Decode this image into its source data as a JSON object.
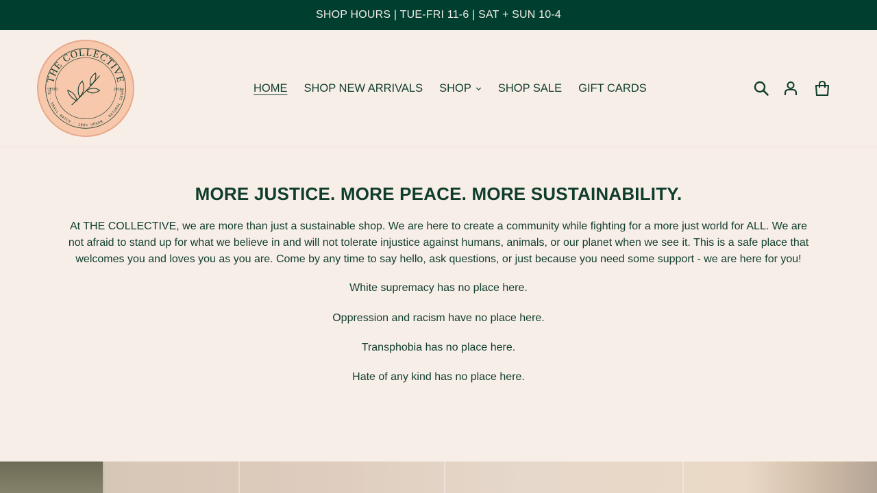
{
  "announcement": {
    "text": "SHOP HOURS | TUE-FRI 11-6 | SAT + SUN 10-4"
  },
  "header": {
    "logo": {
      "brand_name": "THE COLLECTIVE",
      "established_left": "ESTD",
      "established_right": "2019",
      "ring_text": "LOW WASTE · SMALL BATCH · 100% VEGAN · NATURAL INGREDIENTS"
    },
    "nav": [
      {
        "label": "HOME",
        "active": true
      },
      {
        "label": "SHOP NEW ARRIVALS"
      },
      {
        "label": "SHOP",
        "has_dropdown": true
      },
      {
        "label": "SHOP SALE"
      },
      {
        "label": "GIFT CARDS"
      }
    ],
    "icons": [
      "search-icon",
      "account-icon",
      "cart-icon"
    ]
  },
  "main": {
    "headline": "MORE JUSTICE. MORE PEACE. MORE SUSTAINABILITY.",
    "intro": "At THE COLLECTIVE, we are more than just a sustainable shop. We are here to create a community while fighting for a more just world for ALL. We are not afraid to stand up for what we believe in and will not tolerate injustice against humans, animals, or our planet when we see it. This is a safe place that welcomes you and loves you as you are. Come by any time to say hello, ask questions, or just because you need some support - we are here for you!",
    "statements": [
      "White supremacy has no place here.",
      "Oppression and racism have no place here.",
      "Transphobia has no place here.",
      "Hate of any kind has no place here."
    ]
  },
  "colors": {
    "announcement_bg": "#003f30",
    "page_bg": "#f8eee8",
    "text": "#0f3d2c",
    "logo_fill": "#f8c8ad"
  }
}
